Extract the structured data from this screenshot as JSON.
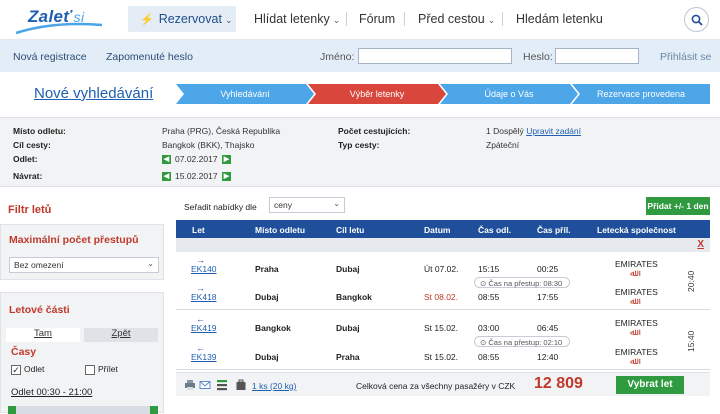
{
  "header": {
    "logo_text": "Zaleť si",
    "nav": {
      "reserve": "Rezervovat",
      "find": "Hlídat letenky",
      "forum": "Fórum",
      "before": "Před cestou",
      "seek": "Hledám letenku"
    }
  },
  "login": {
    "register": "Nová registrace",
    "forgot": "Zapomenuté heslo",
    "name_label": "Jméno:",
    "name_value": "",
    "pass_label": "Heslo:",
    "pass_value": "",
    "submit": "Přihlásit se"
  },
  "new_search": "Nové vyhledávání",
  "steps": [
    "Vyhledávání",
    "Výběr letenky",
    "Údaje o Vás",
    "Rezervace provedena"
  ],
  "active_step_index": 1,
  "trip": {
    "origin_label": "Místo odletu:",
    "origin": "Praha (PRG), Česká Republika",
    "dest_label": "Cíl cesty:",
    "dest": "Bangkok (BKK), Thajsko",
    "dep_label": "Odlet:",
    "dep": "07.02.2017",
    "ret_label": "Návrat:",
    "ret": "15.02.2017",
    "pax_label": "Počet cestujících:",
    "pax": "1 Dospělý",
    "pax_edit": "Upravit zadání",
    "type_label": "Typ cesty:",
    "type": "Zpáteční"
  },
  "filters": {
    "title": "Filtr letů",
    "max_transfers_title": "Maximální počet přestupů",
    "max_transfers_value": "Bez omezení",
    "parts_title": "Letové části",
    "tab_there": "Tam",
    "tab_back": "Zpět",
    "times_title": "Časy",
    "dep_cb": "Odlet",
    "arr_cb": "Přílet",
    "dep_checked": true,
    "arr_checked": false,
    "dep_range": "Odlet 00:30 - 21:00"
  },
  "sort": {
    "label": "Seřadit nabídky dle",
    "value": "ceny"
  },
  "add_button": "Přidat +/- 1 den",
  "table": {
    "headers": [
      "Let",
      "Místo odletu",
      "Cíl letu",
      "Datum",
      "Čas odl.",
      "Čas příl.",
      "Letecká společnost"
    ],
    "close": "X",
    "groups": [
      {
        "duration": "20:40",
        "transfer": "Čas na přestup: 08:30",
        "rows": [
          {
            "dir": "→",
            "flight": "EK140",
            "from": "Praha",
            "to": "Dubaj",
            "date": "Út 07.02.",
            "date_red": false,
            "dep": "15:15",
            "arr": "00:25",
            "airline": "EMIRATES"
          },
          {
            "dir": "→",
            "flight": "EK418",
            "from": "Dubaj",
            "to": "Bangkok",
            "date": "St 08.02.",
            "date_red": true,
            "dep": "08:55",
            "arr": "17:55",
            "airline": "EMIRATES"
          }
        ]
      },
      {
        "duration": "15:40",
        "transfer": "Čas na přestup: 02:10",
        "rows": [
          {
            "dir": "←",
            "flight": "EK419",
            "from": "Bangkok",
            "to": "Dubaj",
            "date": "St 15.02.",
            "date_red": false,
            "dep": "03:00",
            "arr": "06:45",
            "airline": "EMIRATES"
          },
          {
            "dir": "←",
            "flight": "EK139",
            "from": "Dubaj",
            "to": "Praha",
            "date": "St 15.02.",
            "date_red": false,
            "dep": "08:55",
            "arr": "12:40",
            "airline": "EMIRATES"
          }
        ]
      }
    ]
  },
  "footer": {
    "bag": "1 ks (20 kg)",
    "total_label": "Celková cena za všechny pasažéry v CZK",
    "price": "12 809",
    "select": "Vybrat let"
  },
  "colors": {
    "brand": "#1f4f9a",
    "accent_red": "#c0392b",
    "green": "#2f9a3f",
    "step_blue": "#4da6e8",
    "step_red": "#d9473c"
  }
}
